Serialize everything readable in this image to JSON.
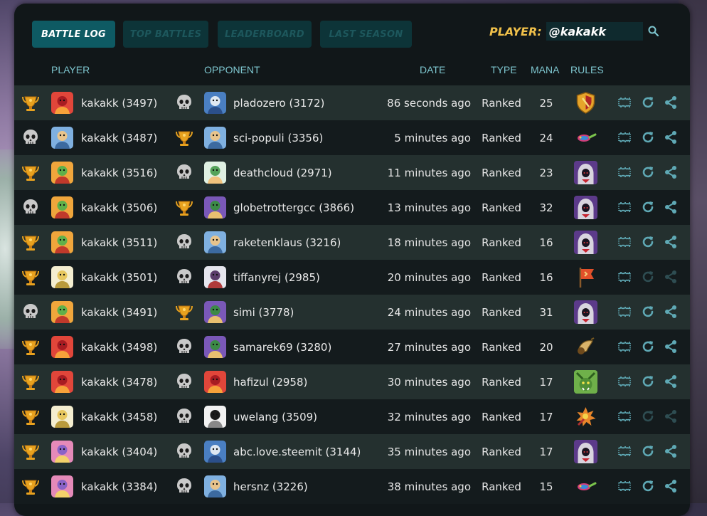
{
  "colors": {
    "accent": "#0e5a63",
    "gold": "#f0c04a",
    "header_text": "#7ec6cf",
    "row_odd": "#24302f",
    "row_even": "#141b1d"
  },
  "nav": {
    "tabs": [
      {
        "label": "BATTLE LOG",
        "active": true
      },
      {
        "label": "TOP BATTLES",
        "active": false
      },
      {
        "label": "LEADERBOARD",
        "active": false
      },
      {
        "label": "LAST SEASON",
        "active": false
      }
    ]
  },
  "search": {
    "label": "PLAYER:",
    "value": "@kakakk",
    "icon": "search-icon"
  },
  "headers": {
    "player": "PLAYER",
    "opponent": "OPPONENT",
    "date": "DATE",
    "type": "TYPE",
    "mana": "MANA",
    "rules": "RULES"
  },
  "rows": [
    {
      "player_result": "win",
      "player": "kakakk (3497)",
      "player_avatar": "red-dragon",
      "opp_result": "loss",
      "opponent": "pladozero (3172)",
      "opp_avatar": "wizard",
      "date": "86 seconds ago",
      "type": "Ranked",
      "mana": "25",
      "rule": "shield",
      "replay_active": true
    },
    {
      "player_result": "loss",
      "player": "kakakk (3487)",
      "player_avatar": "hero",
      "opp_result": "win",
      "opponent": "sci-populi (3356)",
      "opp_avatar": "hero",
      "date": "5 minutes ago",
      "type": "Ranked",
      "mana": "24",
      "rule": "snake",
      "replay_active": true
    },
    {
      "player_result": "win",
      "player": "kakakk (3516)",
      "player_avatar": "goblin",
      "opp_result": "loss",
      "opponent": "deathcloud (2971)",
      "opp_avatar": "elf",
      "date": "11 minutes ago",
      "type": "Ranked",
      "mana": "23",
      "rule": "hooded",
      "replay_active": true
    },
    {
      "player_result": "loss",
      "player": "kakakk (3506)",
      "player_avatar": "goblin",
      "opp_result": "win",
      "opponent": "globetrottergcc (3866)",
      "opp_avatar": "mage",
      "date": "13 minutes ago",
      "type": "Ranked",
      "mana": "32",
      "rule": "hooded",
      "replay_active": true
    },
    {
      "player_result": "win",
      "player": "kakakk (3511)",
      "player_avatar": "goblin",
      "opp_result": "loss",
      "opponent": "raketenklaus (3216)",
      "opp_avatar": "hero",
      "date": "18 minutes ago",
      "type": "Ranked",
      "mana": "16",
      "rule": "hooded",
      "replay_active": true
    },
    {
      "player_result": "win",
      "player": "kakakk (3501)",
      "player_avatar": "teapot",
      "opp_result": "loss",
      "opponent": "tiffanyrej (2985)",
      "opp_avatar": "dark",
      "date": "20 minutes ago",
      "type": "Ranked",
      "mana": "16",
      "rule": "flag",
      "replay_active": false
    },
    {
      "player_result": "loss",
      "player": "kakakk (3491)",
      "player_avatar": "goblin",
      "opp_result": "win",
      "opponent": "simi (3778)",
      "opp_avatar": "mage",
      "date": "24 minutes ago",
      "type": "Ranked",
      "mana": "31",
      "rule": "hooded",
      "replay_active": true
    },
    {
      "player_result": "win",
      "player": "kakakk (3498)",
      "player_avatar": "red-dragon",
      "opp_result": "loss",
      "opponent": "samarek69 (3280)",
      "opp_avatar": "mage",
      "date": "27 minutes ago",
      "type": "Ranked",
      "mana": "20",
      "rule": "horn",
      "replay_active": true
    },
    {
      "player_result": "win",
      "player": "kakakk (3478)",
      "player_avatar": "red-dragon",
      "opp_result": "loss",
      "opponent": "hafizul (2958)",
      "opp_avatar": "red-dragon",
      "date": "30 minutes ago",
      "type": "Ranked",
      "mana": "17",
      "rule": "orc",
      "replay_active": true
    },
    {
      "player_result": "win",
      "player": "kakakk (3458)",
      "player_avatar": "teapot",
      "opp_result": "loss",
      "opponent": "uwelang (3509)",
      "opp_avatar": "ghost",
      "date": "32 minutes ago",
      "type": "Ranked",
      "mana": "17",
      "rule": "explosion",
      "replay_active": false
    },
    {
      "player_result": "win",
      "player": "kakakk (3404)",
      "player_avatar": "princess",
      "opp_result": "loss",
      "opponent": "abc.love.steemit (3144)",
      "opp_avatar": "wizard",
      "date": "35 minutes ago",
      "type": "Ranked",
      "mana": "17",
      "rule": "hooded",
      "replay_active": true
    },
    {
      "player_result": "win",
      "player": "kakakk (3384)",
      "player_avatar": "princess",
      "opp_result": "loss",
      "opponent": "hersnz (3226)",
      "opp_avatar": "hero",
      "date": "38 minutes ago",
      "type": "Ranked",
      "mana": "15",
      "rule": "snake",
      "replay_active": true
    }
  ]
}
